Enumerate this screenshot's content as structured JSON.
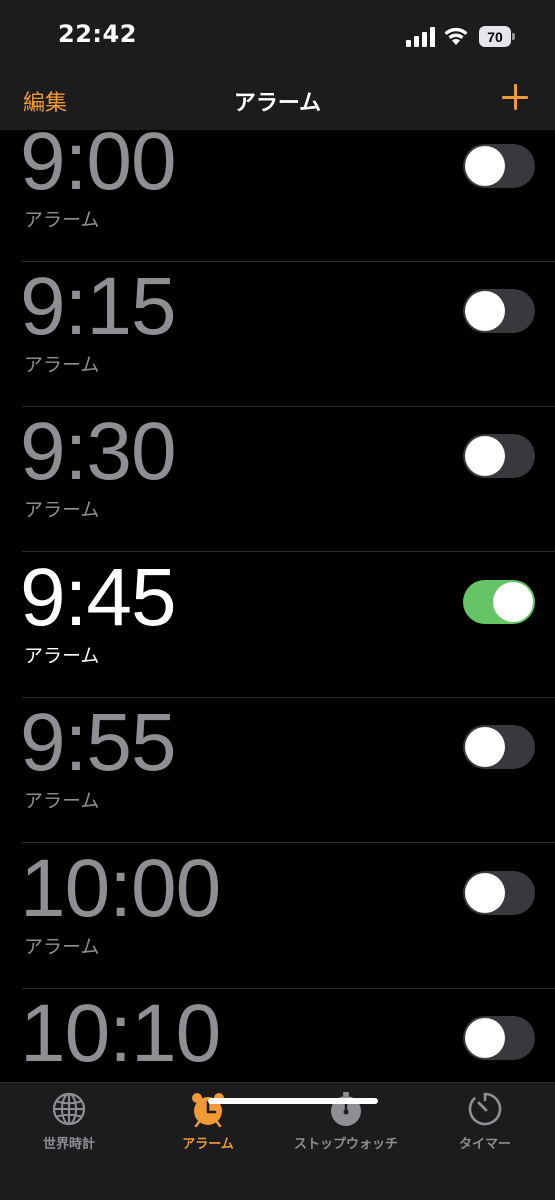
{
  "status_bar": {
    "time": "22:42",
    "battery_level": "70",
    "icons": [
      "signal-icon",
      "wifi-icon",
      "battery-icon"
    ]
  },
  "nav": {
    "edit_label": "編集",
    "title": "アラーム",
    "add_icon": "plus-icon"
  },
  "alarms": [
    {
      "time": "9:00",
      "label": "アラーム",
      "enabled": false
    },
    {
      "time": "9:15",
      "label": "アラーム",
      "enabled": false
    },
    {
      "time": "9:30",
      "label": "アラーム",
      "enabled": false
    },
    {
      "time": "9:45",
      "label": "アラーム",
      "enabled": true
    },
    {
      "time": "9:55",
      "label": "アラーム",
      "enabled": false
    },
    {
      "time": "10:00",
      "label": "アラーム",
      "enabled": false
    },
    {
      "time": "10:10",
      "label": "",
      "enabled": false
    }
  ],
  "tabs": [
    {
      "label": "世界時計",
      "icon": "globe-icon",
      "active": false
    },
    {
      "label": "アラーム",
      "icon": "alarm-clock-icon",
      "active": true
    },
    {
      "label": "ストップウォッチ",
      "icon": "stopwatch-icon",
      "active": false
    },
    {
      "label": "タイマー",
      "icon": "timer-icon",
      "active": false
    }
  ],
  "colors": {
    "accent": "#f09a37",
    "toggle_on": "#65c466",
    "toggle_off": "#39393d",
    "inactive_text": "#8e8e93"
  }
}
